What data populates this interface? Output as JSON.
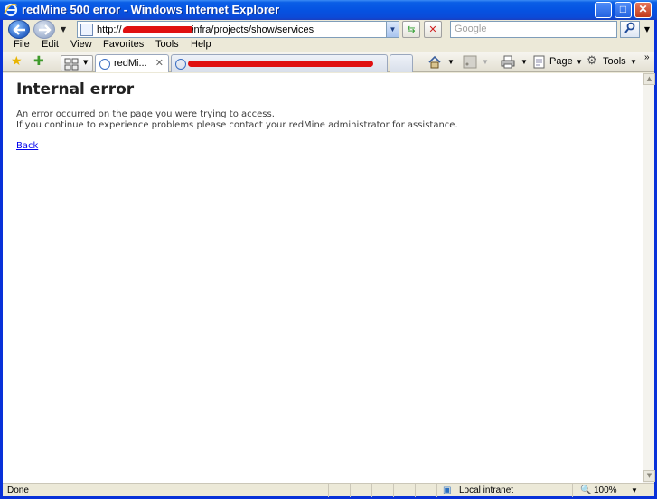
{
  "window": {
    "title": "redMine 500 error - Windows Internet Explorer"
  },
  "address": {
    "url_prefix": "http://",
    "url_path": "infra/projects/show/services",
    "search_placeholder": "Google"
  },
  "menu": [
    "File",
    "Edit",
    "View",
    "Favorites",
    "Tools",
    "Help"
  ],
  "tabs": [
    {
      "label": "redMi..."
    },
    {
      "label": ""
    }
  ],
  "toolbar": {
    "page_label": "Page",
    "tools_label": "Tools"
  },
  "page": {
    "heading": "Internal error",
    "line1": "An error occurred on the page you were trying to access.",
    "line2": "If you continue to experience problems please contact your redMine administrator for assistance.",
    "back": "Back"
  },
  "status": {
    "text": "Done",
    "zone": "Local intranet",
    "zoom": "100%"
  },
  "colors": {
    "title_bar": "#0553e2",
    "link": "#0000ee",
    "redaction": "#e01010"
  }
}
